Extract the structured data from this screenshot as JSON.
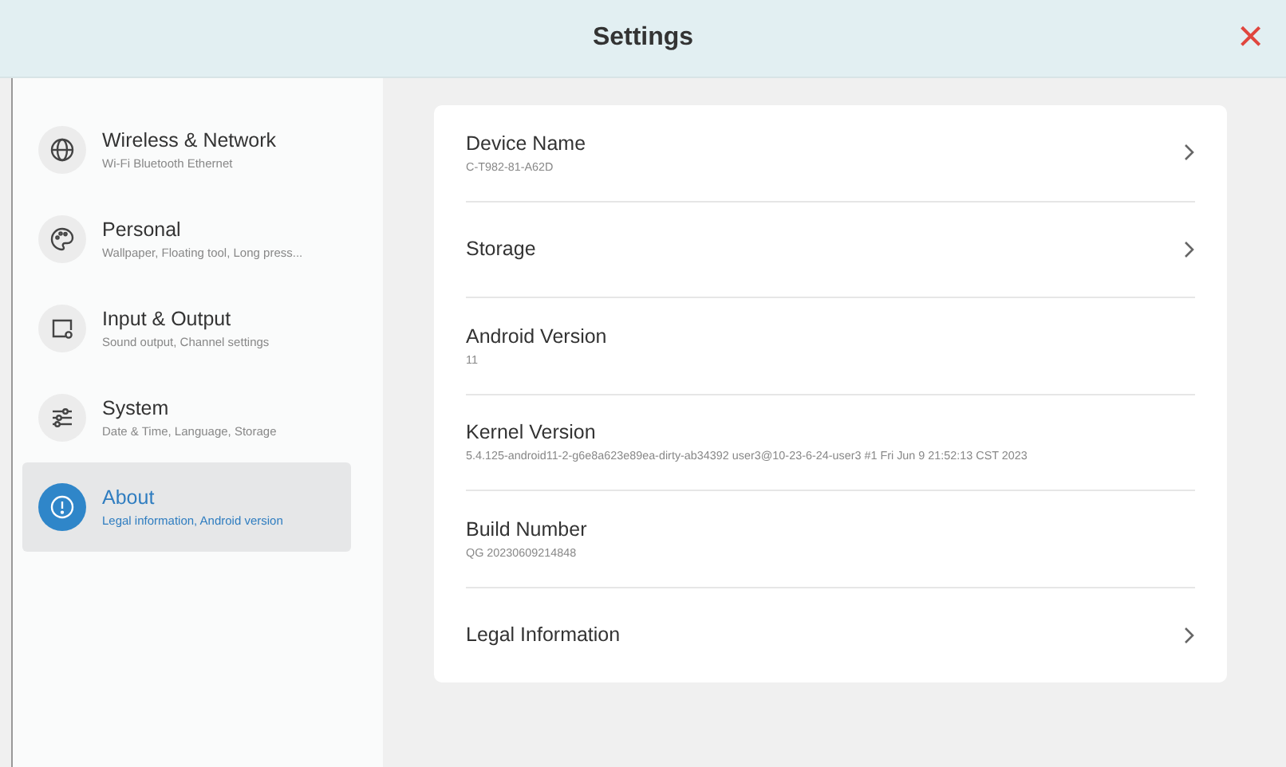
{
  "window": {
    "title": "Settings",
    "close": "×"
  },
  "sidebar": {
    "items": [
      {
        "kind": "globe",
        "title": "Wireless & Network",
        "subtitle": "Wi-Fi Bluetooth Ethernet",
        "selected": false
      },
      {
        "kind": "palette",
        "title": "Personal",
        "subtitle": "Wallpaper, Floating tool, Long press...",
        "selected": false
      },
      {
        "kind": "display",
        "title": "Input & Output",
        "subtitle": "Sound output, Channel settings",
        "selected": false
      },
      {
        "kind": "sliders",
        "title": "System",
        "subtitle": "Date & Time, Language, Storage",
        "selected": false
      },
      {
        "kind": "info",
        "title": "About",
        "subtitle": "Legal information, Android version",
        "selected": true
      }
    ]
  },
  "rows": [
    {
      "title": "Device Name",
      "value": "C-T982-81-A62D",
      "chevron": true
    },
    {
      "title": "Storage",
      "chevron": true
    },
    {
      "title": "Android Version",
      "value": "11",
      "chevron": false
    },
    {
      "title": "Kernel Version",
      "value": "5.4.125-android11-2-g6e8a623e89ea-dirty-ab34392   user3@10-23-6-24-user3 #1 Fri Jun 9 21:52:13 CST 2023",
      "chevron": false
    },
    {
      "title": "Build Number",
      "value": "QG 20230609214848",
      "chevron": false
    },
    {
      "title": "Legal Information",
      "chevron": true
    }
  ]
}
